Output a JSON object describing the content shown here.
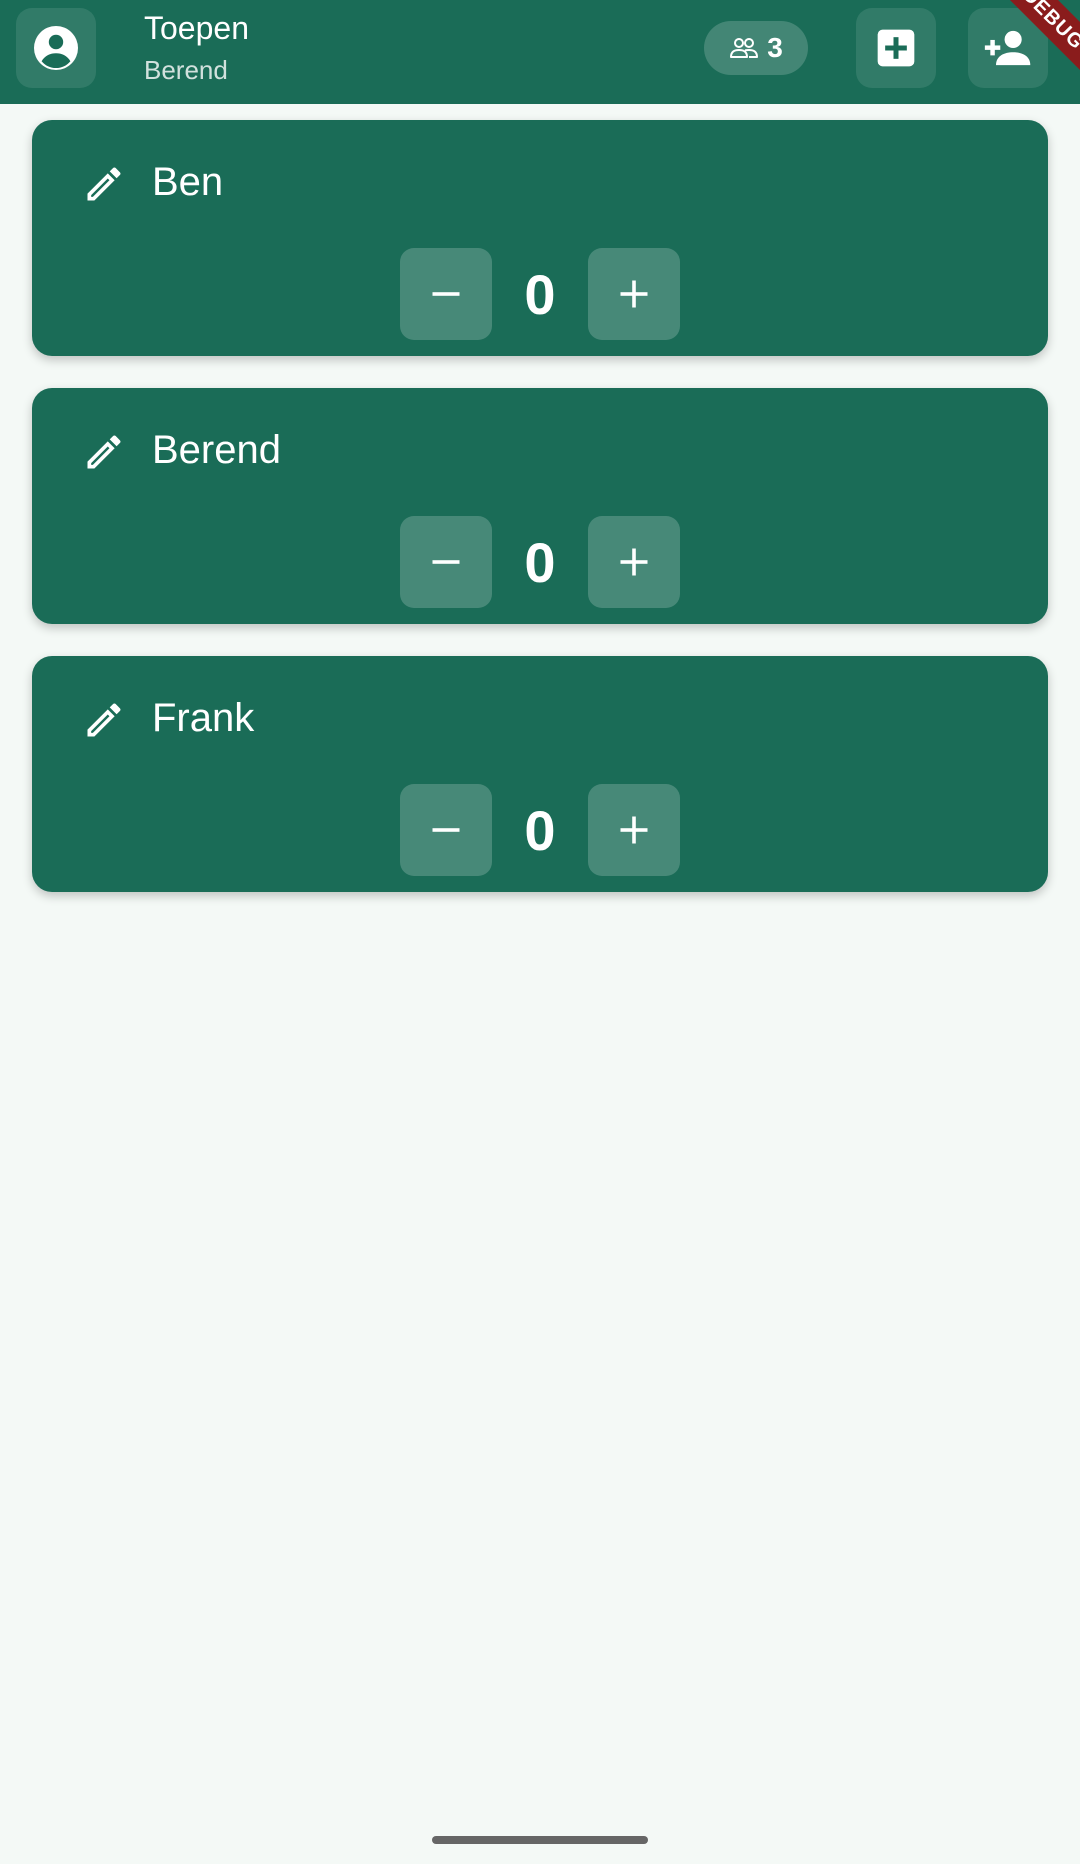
{
  "app_bar": {
    "title": "Toepen",
    "subtitle": "Berend",
    "profile_icon": "account-circle-icon",
    "players_icon": "group-icon",
    "players_count": "3",
    "new_game_icon": "add-box-icon",
    "add_player_icon": "person-add-icon",
    "debug_banner": "DEBUG"
  },
  "players": [
    {
      "name": "Ben",
      "score": "0"
    },
    {
      "name": "Berend",
      "score": "0"
    },
    {
      "name": "Frank",
      "score": "0"
    }
  ],
  "icons": {
    "edit": "pencil-icon",
    "decrement": "minus-icon",
    "increment": "plus-icon"
  },
  "colors": {
    "primary": "#1a6c57",
    "background": "#f4f9f6",
    "debug_banner": "#8a1c1c"
  }
}
